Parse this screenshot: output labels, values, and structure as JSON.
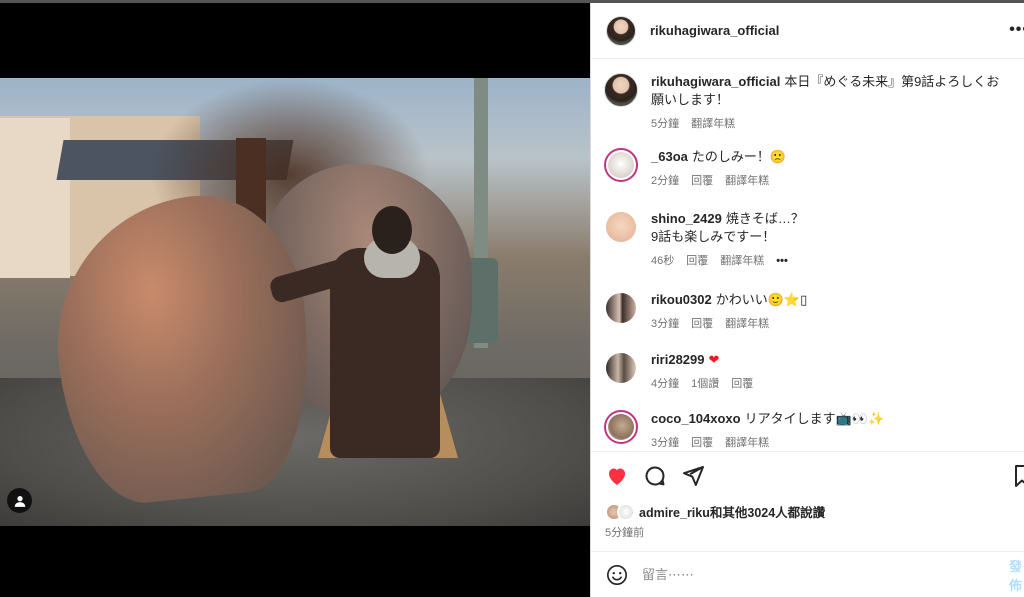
{
  "post": {
    "owner": "rikuhagiwara_official",
    "more_icon": "ellipsis-icon",
    "caption": {
      "username": "rikuhagiwara_official",
      "text": "本日『めぐる未来』第9話よろしくお願いします！",
      "age": "5分鐘",
      "translate": "翻譯年糕"
    }
  },
  "comments": [
    {
      "username": "_63oa",
      "text": "たのしみー！🙁",
      "age": "2分鐘",
      "reply": "回覆",
      "translate": "翻譯年糕"
    },
    {
      "username": "shino_2429",
      "text": "焼きそば…？\n9話も楽しみですー！",
      "age": "46秒",
      "reply": "回覆",
      "translate": "翻譯年糕",
      "more": "•••"
    },
    {
      "username": "rikou0302",
      "text": "かわいい🙂⭐▯",
      "age": "3分鐘",
      "reply": "回覆",
      "translate": "翻譯年糕"
    },
    {
      "username": "riri28299",
      "text": "❤",
      "age": "4分鐘",
      "likes": "1個讚",
      "reply": "回覆"
    },
    {
      "username": "coco_104xoxo",
      "text": "リアタイします📺👀✨",
      "age": "3分鐘",
      "reply": "回覆",
      "translate": "翻譯年糕"
    }
  ],
  "actions": {
    "like_icon": "heart-icon",
    "comment_icon": "comment-icon",
    "share_icon": "send-icon",
    "save_icon": "bookmark-icon",
    "liked_color": "#ff3040"
  },
  "likes": {
    "text": "admire_riku和其他3024人都說讚"
  },
  "timestamp": "5分鐘前",
  "add_comment": {
    "placeholder": "留言⋯⋯",
    "post": "發佈"
  }
}
